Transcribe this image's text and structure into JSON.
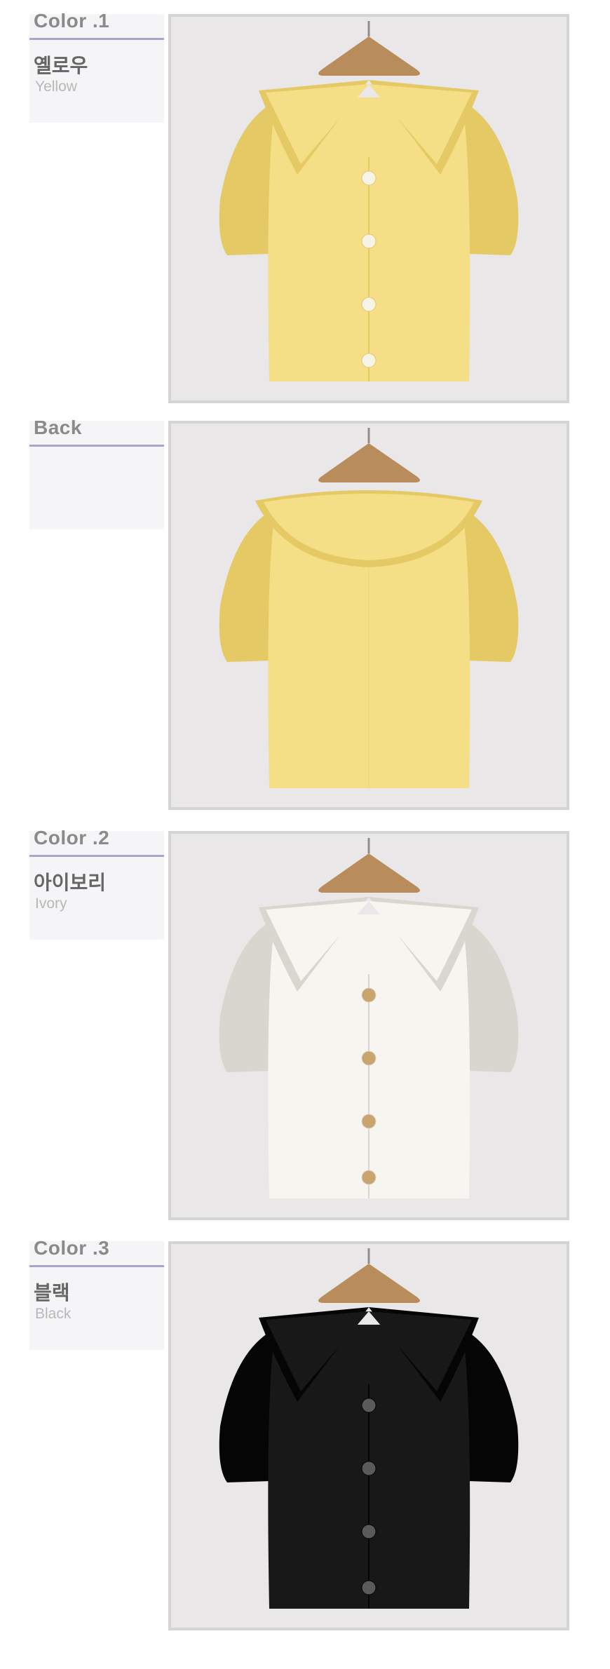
{
  "sections": [
    {
      "title": "Color .1",
      "name_ko": "옐로우",
      "name_en": "Yellow",
      "variant": "front",
      "color": "#f4de86",
      "color_dark": "#e5c965",
      "button_color": "#f7f3e6"
    },
    {
      "title": "Back",
      "name_ko": "",
      "name_en": "",
      "variant": "back",
      "color": "#f4de86",
      "color_dark": "#e5c965",
      "button_color": "#f7f3e6"
    },
    {
      "title": "Color .2",
      "name_ko": "아이보리",
      "name_en": "Ivory",
      "variant": "front",
      "color": "#f7f5f0",
      "color_dark": "#d9d6cf",
      "button_color": "#c9a56d"
    },
    {
      "title": "Color .3",
      "name_ko": "블랙",
      "name_en": "Black",
      "variant": "front",
      "color": "#181818",
      "color_dark": "#050505",
      "button_color": "#5a5a5a"
    }
  ]
}
